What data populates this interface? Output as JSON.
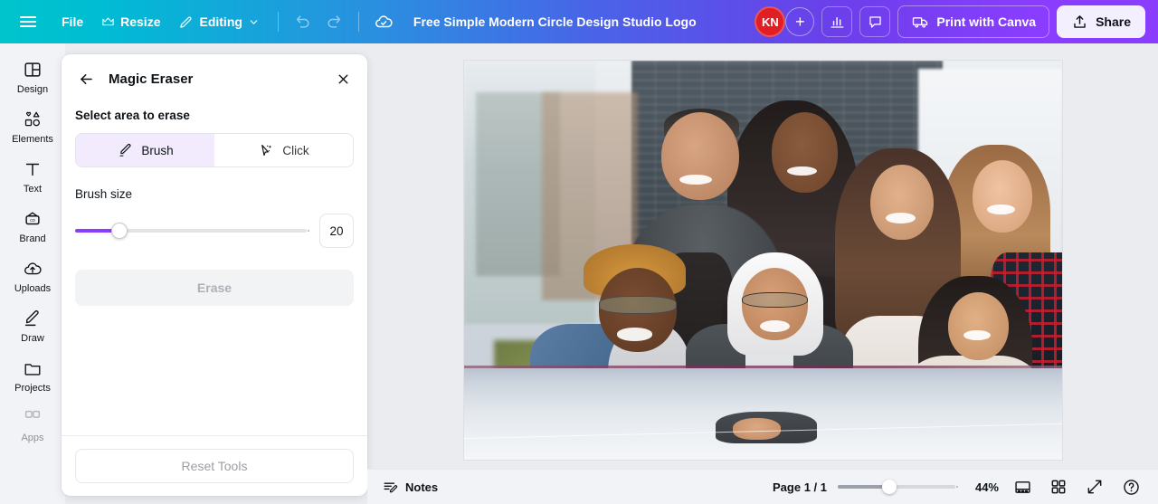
{
  "topbar": {
    "menu_icon": "hamburger-icon",
    "file_label": "File",
    "resize_label": "Resize",
    "resize_icon": "crown-icon",
    "editing_label": "Editing",
    "editing_icon": "pencil-icon",
    "editing_caret": "chevron-down-icon",
    "undo_icon": "undo-icon",
    "redo_icon": "redo-icon",
    "cloud_icon": "cloud-check-icon",
    "design_title": "Free Simple Modern Circle Design Studio Logo",
    "avatar_initials": "KN",
    "avatar_color": "#e01e24",
    "add_member_label": "+",
    "insights_icon": "bar-chart-icon",
    "comments_icon": "comment-icon",
    "print_label": "Print with Canva",
    "print_icon": "truck-icon",
    "share_label": "Share",
    "share_icon": "upload-icon",
    "gradient_from": "#00c4cc",
    "gradient_to": "#8b3dff"
  },
  "sidebar": {
    "items": [
      {
        "label": "Design",
        "icon": "layout-panels-icon"
      },
      {
        "label": "Elements",
        "icon": "shapes-icon"
      },
      {
        "label": "Text",
        "icon": "text-t-icon"
      },
      {
        "label": "Brand",
        "icon": "brand-badge-icon"
      },
      {
        "label": "Uploads",
        "icon": "cloud-upload-icon"
      },
      {
        "label": "Draw",
        "icon": "pen-draw-icon"
      },
      {
        "label": "Projects",
        "icon": "folder-icon"
      },
      {
        "label": "Apps",
        "icon": "apps-grid-icon"
      }
    ]
  },
  "panel": {
    "back_icon": "arrow-left-icon",
    "title": "Magic Eraser",
    "close_icon": "close-icon",
    "section_label": "Select area to erase",
    "modes": [
      {
        "label": "Brush",
        "icon": "brush-pen-icon",
        "selected": true
      },
      {
        "label": "Click",
        "icon": "magic-cursor-icon",
        "selected": false
      }
    ],
    "brush_size_label": "Brush size",
    "brush_size_value": "20",
    "brush_slider_percent": 19,
    "accent_color": "#8b3dff",
    "erase_label": "Erase",
    "erase_enabled": false,
    "reset_label": "Reset Tools",
    "reset_enabled": false
  },
  "canvas": {
    "image_alt": "Group of seven diverse smiling young students leaning over a white table",
    "background_color": "#ebecf0"
  },
  "bottombar": {
    "notes_label": "Notes",
    "notes_icon": "notes-pencil-icon",
    "page_indicator": "Page 1 / 1",
    "zoom_percent_label": "44%",
    "zoom_slider_percent": 44,
    "page_view_icon": "page-view-icon",
    "grid_view_icon": "grid-view-icon",
    "fullscreen_icon": "expand-arrows-icon",
    "help_icon": "help-circle-icon"
  }
}
